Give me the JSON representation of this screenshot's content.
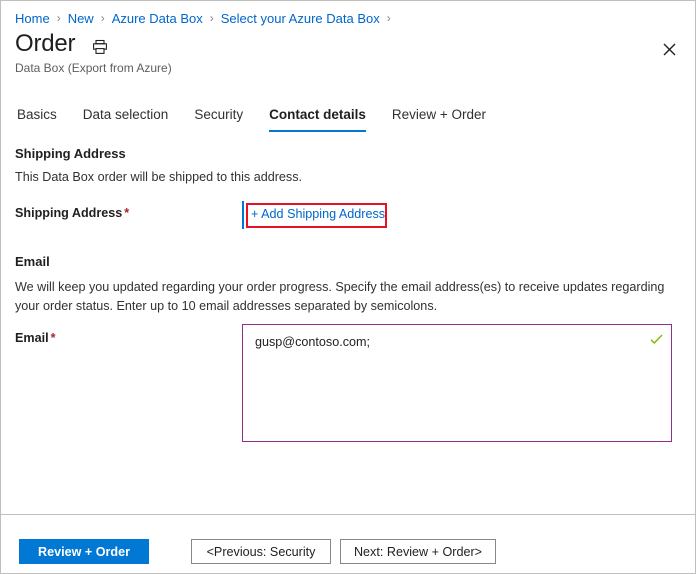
{
  "breadcrumb": {
    "separator": "›",
    "items": [
      {
        "label": "Home"
      },
      {
        "label": "New"
      },
      {
        "label": "Azure Data Box"
      },
      {
        "label": "Select your Azure Data Box"
      }
    ]
  },
  "header": {
    "title": "Order",
    "subtitle": "Data Box (Export from Azure)",
    "print_icon": "print-icon",
    "close_icon": "close-icon"
  },
  "tabs": [
    {
      "label": "Basics",
      "active": false
    },
    {
      "label": "Data selection",
      "active": false
    },
    {
      "label": "Security",
      "active": false
    },
    {
      "label": "Contact details",
      "active": true
    },
    {
      "label": "Review + Order",
      "active": false
    }
  ],
  "shipping": {
    "heading": "Shipping Address",
    "description": "This Data Box order will be shipped to this address.",
    "field_label": "Shipping Address",
    "required_marker": "*",
    "add_link": "+ Add Shipping Address",
    "highlight_color": "#e81123",
    "accent_bar_color": "#0078d4"
  },
  "email": {
    "heading": "Email",
    "description": "We will keep you updated regarding your order progress. Specify the email address(es) to receive updates regarding your order status. Enter up to 10 email addresses separated by semicolons.",
    "field_label": "Email",
    "required_marker": "*",
    "value": "gusp@contoso.com;",
    "placeholder": "",
    "valid_icon": "checkmark-icon",
    "border_color": "#8e2f8e",
    "valid_color": "#7cbb00"
  },
  "footer": {
    "primary_button": "Review + Order",
    "previous_button": "<Previous: Security",
    "next_button": "Next: Review + Order>",
    "primary_color": "#0078d4"
  }
}
